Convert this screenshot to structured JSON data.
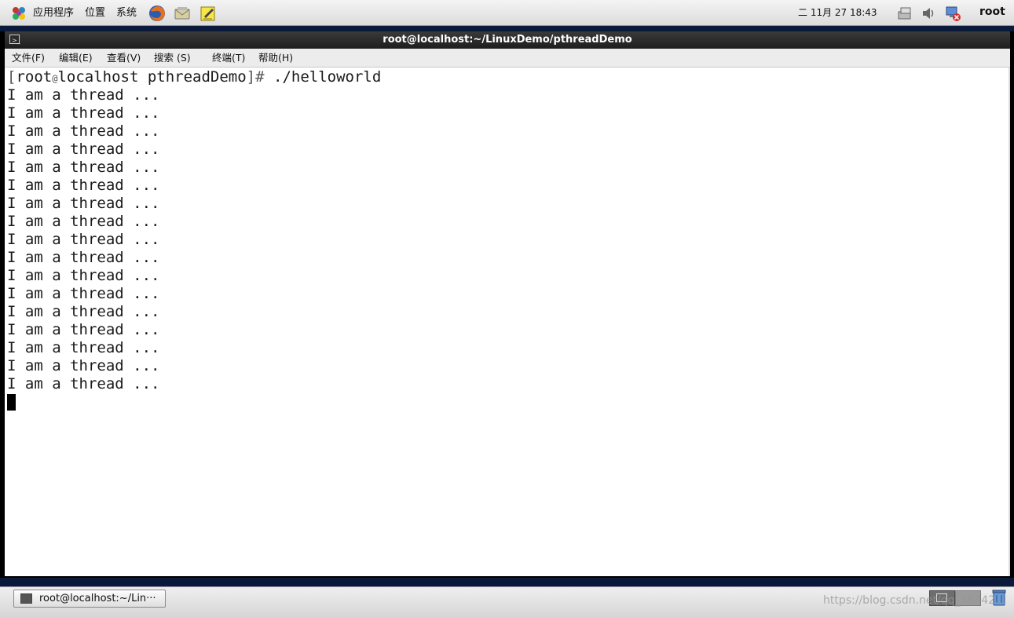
{
  "top_panel": {
    "menus": [
      "应用程序",
      "位置",
      "系统"
    ],
    "launchers": [
      "firefox-icon",
      "mail-icon",
      "notes-icon"
    ],
    "clock": "二 11月 27 18:43",
    "tray": [
      "network-icon",
      "volume-icon",
      "network-disconnected-icon"
    ],
    "user": "root"
  },
  "window": {
    "title": "root@localhost:~/LinuxDemo/pthreadDemo",
    "menu": [
      "文件(F)",
      "编辑(E)",
      "查看(V)",
      "搜索 (S)",
      "终端(T)",
      "帮助(H)"
    ]
  },
  "terminal": {
    "prompt": {
      "open": "[",
      "user": "root",
      "at": "@",
      "host_dir": "localhost pthreadDemo",
      "close": "]",
      "symbol": "#",
      "command": " ./helloworld"
    },
    "output": [
      "I am a thread ...",
      "I am a thread ...",
      "I am a thread ...",
      "I am a thread ...",
      "I am a thread ...",
      "I am a thread ...",
      "I am a thread ...",
      "I am a thread ...",
      "I am a thread ...",
      "I am a thread ...",
      "I am a thread ...",
      "I am a thread ...",
      "I am a thread ...",
      "I am a thread ...",
      "I am a thread ...",
      "I am a thread ...",
      "I am a thread ..."
    ]
  },
  "taskbar": {
    "task_label": "root@localhost:~/Lin···"
  },
  "watermark": "https://blog.csdn.net/qq_38442..."
}
